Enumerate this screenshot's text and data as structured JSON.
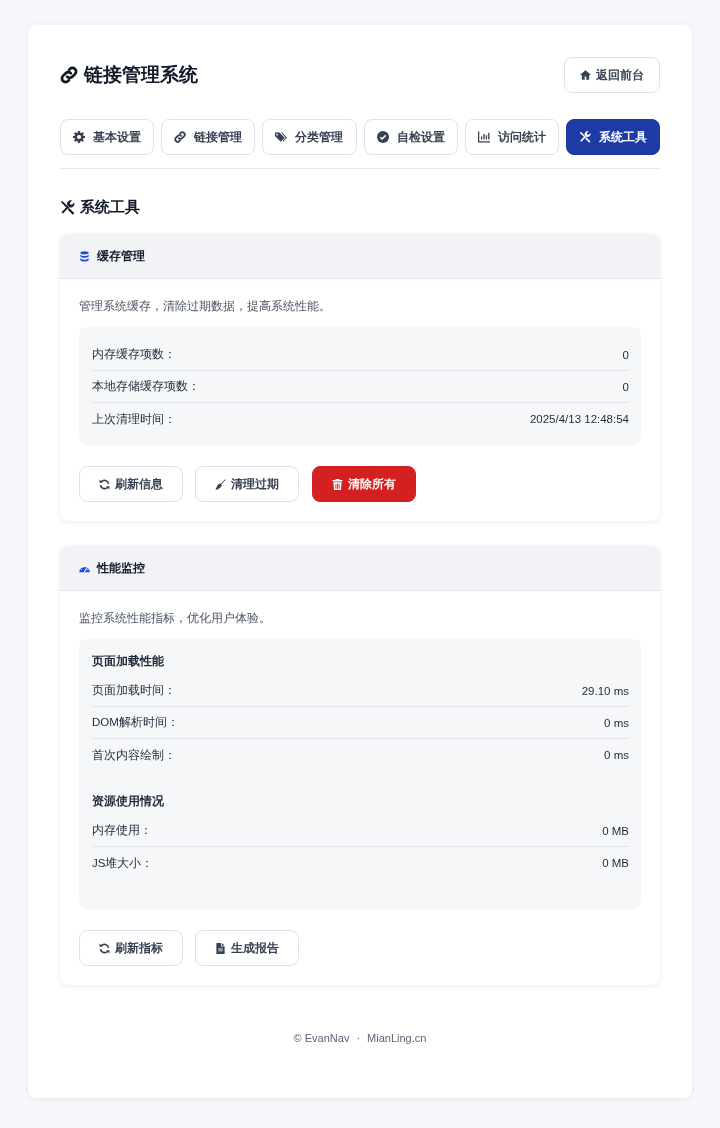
{
  "header": {
    "title": "链接管理系统",
    "back_button": "返回前台"
  },
  "tabs": [
    {
      "kind": "settings",
      "label": "基本设置",
      "selected": false
    },
    {
      "kind": "links",
      "label": "链接管理",
      "selected": false
    },
    {
      "kind": "categories",
      "label": "分类管理",
      "selected": false
    },
    {
      "kind": "check",
      "label": "自检设置",
      "selected": false
    },
    {
      "kind": "stats",
      "label": "访问统计",
      "selected": false
    },
    {
      "kind": "tools",
      "label": "系统工具",
      "selected": true
    }
  ],
  "section_title": "系统工具",
  "cards": [
    {
      "kind": "cache",
      "title": "缓存管理",
      "description": "管理系统缓存，清除过期数据，提高系统性能。",
      "groups": [
        {
          "rows": [
            {
              "label": "内存缓存项数：",
              "value": "0"
            },
            {
              "label": "本地存储缓存项数：",
              "value": "0"
            },
            {
              "label": "上次清理时间：",
              "value": "2025/4/13 12:48:54"
            }
          ]
        }
      ],
      "buttons": [
        {
          "kind": "refresh",
          "label": "刷新信息"
        },
        {
          "kind": "clean",
          "label": "清理过期"
        },
        {
          "kind": "delete",
          "label": "清除所有"
        }
      ]
    },
    {
      "kind": "performance",
      "title": "性能监控",
      "description": "监控系统性能指标，优化用户体验。",
      "groups": [
        {
          "heading": "页面加载性能",
          "rows": [
            {
              "label": "页面加载时间：",
              "value": "29.10 ms"
            },
            {
              "label": "DOM解析时间：",
              "value": "0 ms"
            },
            {
              "label": "首次内容绘制：",
              "value": "0 ms"
            }
          ]
        },
        {
          "heading": "资源使用情况",
          "rows": [
            {
              "label": "内存使用：",
              "value": "0 MB"
            },
            {
              "label": "JS堆大小：",
              "value": "0 MB"
            }
          ]
        }
      ],
      "buttons": [
        {
          "kind": "refresh",
          "label": "刷新指标"
        },
        {
          "kind": "report",
          "label": "生成报告"
        }
      ]
    }
  ],
  "footer": {
    "copyright": "© EvanNav",
    "separator": "·",
    "site": "MianLing.cn"
  }
}
